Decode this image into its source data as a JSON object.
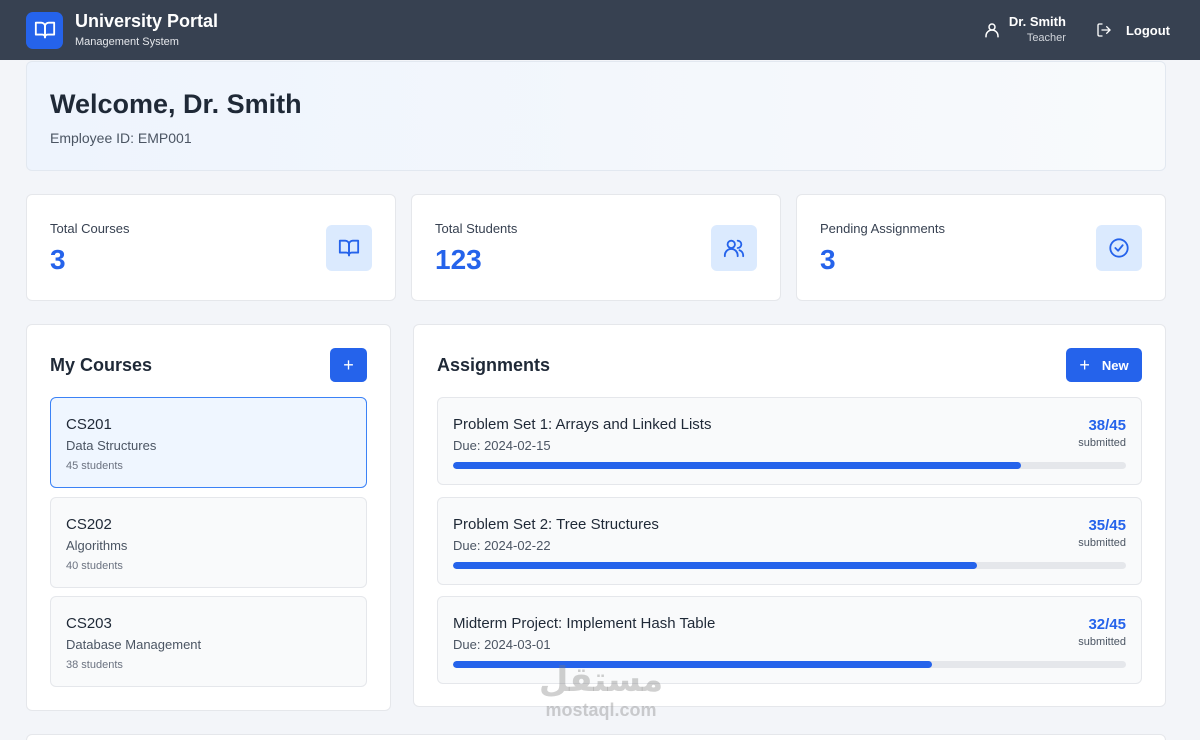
{
  "header": {
    "title": "University Portal",
    "subtitle": "Management System",
    "user_name": "Dr. Smith",
    "user_role": "Teacher",
    "logout_label": "Logout"
  },
  "welcome": {
    "title": "Welcome, Dr. Smith",
    "employee_id": "Employee ID: EMP001"
  },
  "stats": [
    {
      "label": "Total Courses",
      "value": "3",
      "icon": "book-icon"
    },
    {
      "label": "Total Students",
      "value": "123",
      "icon": "users-icon"
    },
    {
      "label": "Pending Assignments",
      "value": "3",
      "icon": "check-circle-icon"
    }
  ],
  "courses": {
    "title": "My Courses",
    "add_label": "+",
    "items": [
      {
        "code": "CS201",
        "name": "Data Structures",
        "students": "45 students",
        "active": true
      },
      {
        "code": "CS202",
        "name": "Algorithms",
        "students": "40 students",
        "active": false
      },
      {
        "code": "CS203",
        "name": "Database Management",
        "students": "38 students",
        "active": false
      }
    ]
  },
  "assignments": {
    "title": "Assignments",
    "new_label": "New",
    "items": [
      {
        "title": "Problem Set 1: Arrays and Linked Lists",
        "due": "Due: 2024-02-15",
        "count": "38/45",
        "submitted_label": "submitted",
        "progress": 0.844
      },
      {
        "title": "Problem Set 2: Tree Structures",
        "due": "Due: 2024-02-22",
        "count": "35/45",
        "submitted_label": "submitted",
        "progress": 0.778
      },
      {
        "title": "Midterm Project: Implement Hash Table",
        "due": "Due: 2024-03-01",
        "count": "32/45",
        "submitted_label": "submitted",
        "progress": 0.711
      }
    ]
  },
  "watermark": {
    "arabic": "مستقل",
    "latin": "mostaql.com"
  },
  "colors": {
    "header_bg": "#374151",
    "accent": "#2563eb",
    "icon_tile": "#dbeafe",
    "page_bg": "#f3f5f9"
  }
}
